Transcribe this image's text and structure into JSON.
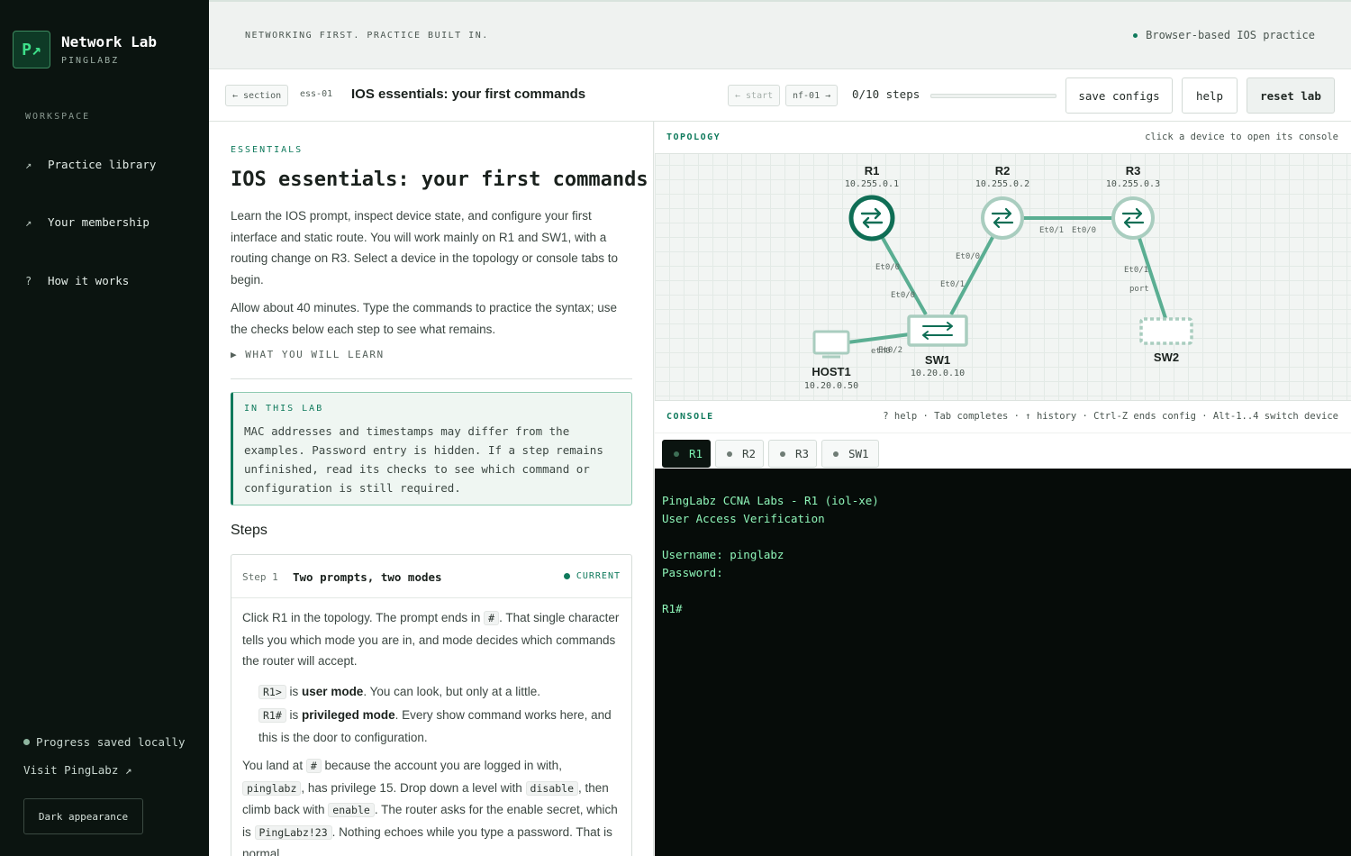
{
  "sidebar": {
    "logo_text": "P↗",
    "brand_title": "Network Lab",
    "brand_subtitle": "PINGLABZ",
    "workspace_label": "WORKSPACE",
    "nav": [
      {
        "icon": "↗",
        "label": "Practice library"
      },
      {
        "icon": "↗",
        "label": "Your membership"
      },
      {
        "icon": "?",
        "label": "How it works"
      }
    ],
    "progress_note": "Progress saved locally",
    "visit_link": "Visit PingLabz ↗",
    "appearance_button": "Dark appearance"
  },
  "topbar": {
    "tagline": "NETWORKING FIRST. PRACTICE BUILT IN.",
    "browser_note": "Browser-based IOS practice"
  },
  "labbar": {
    "back_section": "← section",
    "lab_id": "ess-01",
    "lab_title": "IOS essentials: your first commands",
    "start_chip": "← start",
    "next_chip": "nf-01 →",
    "steps_progress": "0/10 steps",
    "steps_done_fraction": 0,
    "save_button": "save configs",
    "help_button": "help",
    "reset_button": "reset lab"
  },
  "content": {
    "eyebrow": "ESSENTIALS",
    "title": "IOS essentials: your first commands",
    "intro_1": "Learn the IOS prompt, inspect device state, and configure your first interface and static route. You will work mainly on R1 and SW1, with a routing change on R3. Select a device in the topology or console tabs to begin.",
    "intro_2": "Allow about 40 minutes. Type the commands to practice the syntax; use the checks below each step to see what remains.",
    "learn_toggle": "▶ WHAT YOU WILL LEARN",
    "callout_label": "IN THIS LAB",
    "callout_text": "MAC addresses and timestamps may differ from the examples. Password entry is hidden. If a step remains unfinished, read its checks to see which command or configuration is still required.",
    "steps_heading": "Steps",
    "step": {
      "number": "Step 1",
      "title": "Two prompts, two modes",
      "status": "CURRENT",
      "p1_a": "Click R1 in the topology. The prompt ends in ",
      "p1_code": "#",
      "p1_b": ". That single character tells you which mode you are in, and mode decides which commands the router will accept.",
      "li1_code": "R1>",
      "li1_a": " is ",
      "li1_bold": "user mode",
      "li1_b": ". You can look, but only at a little.",
      "li2_code": "R1#",
      "li2_a": " is ",
      "li2_bold": "privileged mode",
      "li2_b": ". Every show command works here, and this is the door to configuration.",
      "p2_a": "You land at ",
      "p2_code1": "#",
      "p2_b": " because the account you are logged in with, ",
      "p2_code2": "pinglabz",
      "p2_c": ", has privilege 15. Drop down a level with ",
      "p2_code3": "disable",
      "p2_d": ", then climb back with ",
      "p2_code4": "enable",
      "p2_e": ". The router asks for the enable secret, which is ",
      "p2_code5": "PingLabz!23",
      "p2_f": ". Nothing echoes while you type a password. That is normal."
    }
  },
  "topology": {
    "label": "TOPOLOGY",
    "hint": "click a device to open its console",
    "devices": {
      "r1": {
        "name": "R1",
        "ip": "10.255.0.1"
      },
      "r2": {
        "name": "R2",
        "ip": "10.255.0.2"
      },
      "r3": {
        "name": "R3",
        "ip": "10.255.0.3"
      },
      "sw1": {
        "name": "SW1",
        "ip": "10.20.0.10"
      },
      "sw2": {
        "name": "SW2"
      },
      "host1": {
        "name": "HOST1",
        "ip": "10.20.0.50"
      }
    },
    "ports": {
      "r1_sw1_r1": "Et0/0",
      "r1_sw1_sw1": "Et0/0",
      "r2_sw1_r2": "Et0/0",
      "r2_sw1_sw1": "Et0/1",
      "r2_r3_r2": "Et0/1",
      "r3_r2_r3": "Et0/0",
      "r3_sw2_r3": "Et0/1",
      "r3_sw2_sw2": "port",
      "host_sw1_host": "eth0",
      "host_sw1_sw1": "Et0/2"
    },
    "colors": {
      "link": "#5aae92",
      "active": "#0f6e55",
      "inactive": "#9dc5b6"
    }
  },
  "console": {
    "label": "CONSOLE",
    "hint": "? help · Tab completes · ↑ history · Ctrl-Z ends config · Alt-1..4 switch device",
    "tabs": [
      "R1",
      "R2",
      "R3",
      "SW1"
    ],
    "active_tab": "R1",
    "lines": [
      "PingLabz CCNA Labs - R1 (iol-xe)",
      "User Access Verification",
      "",
      "Username: pinglabz",
      "Password:",
      "",
      "R1#"
    ]
  }
}
